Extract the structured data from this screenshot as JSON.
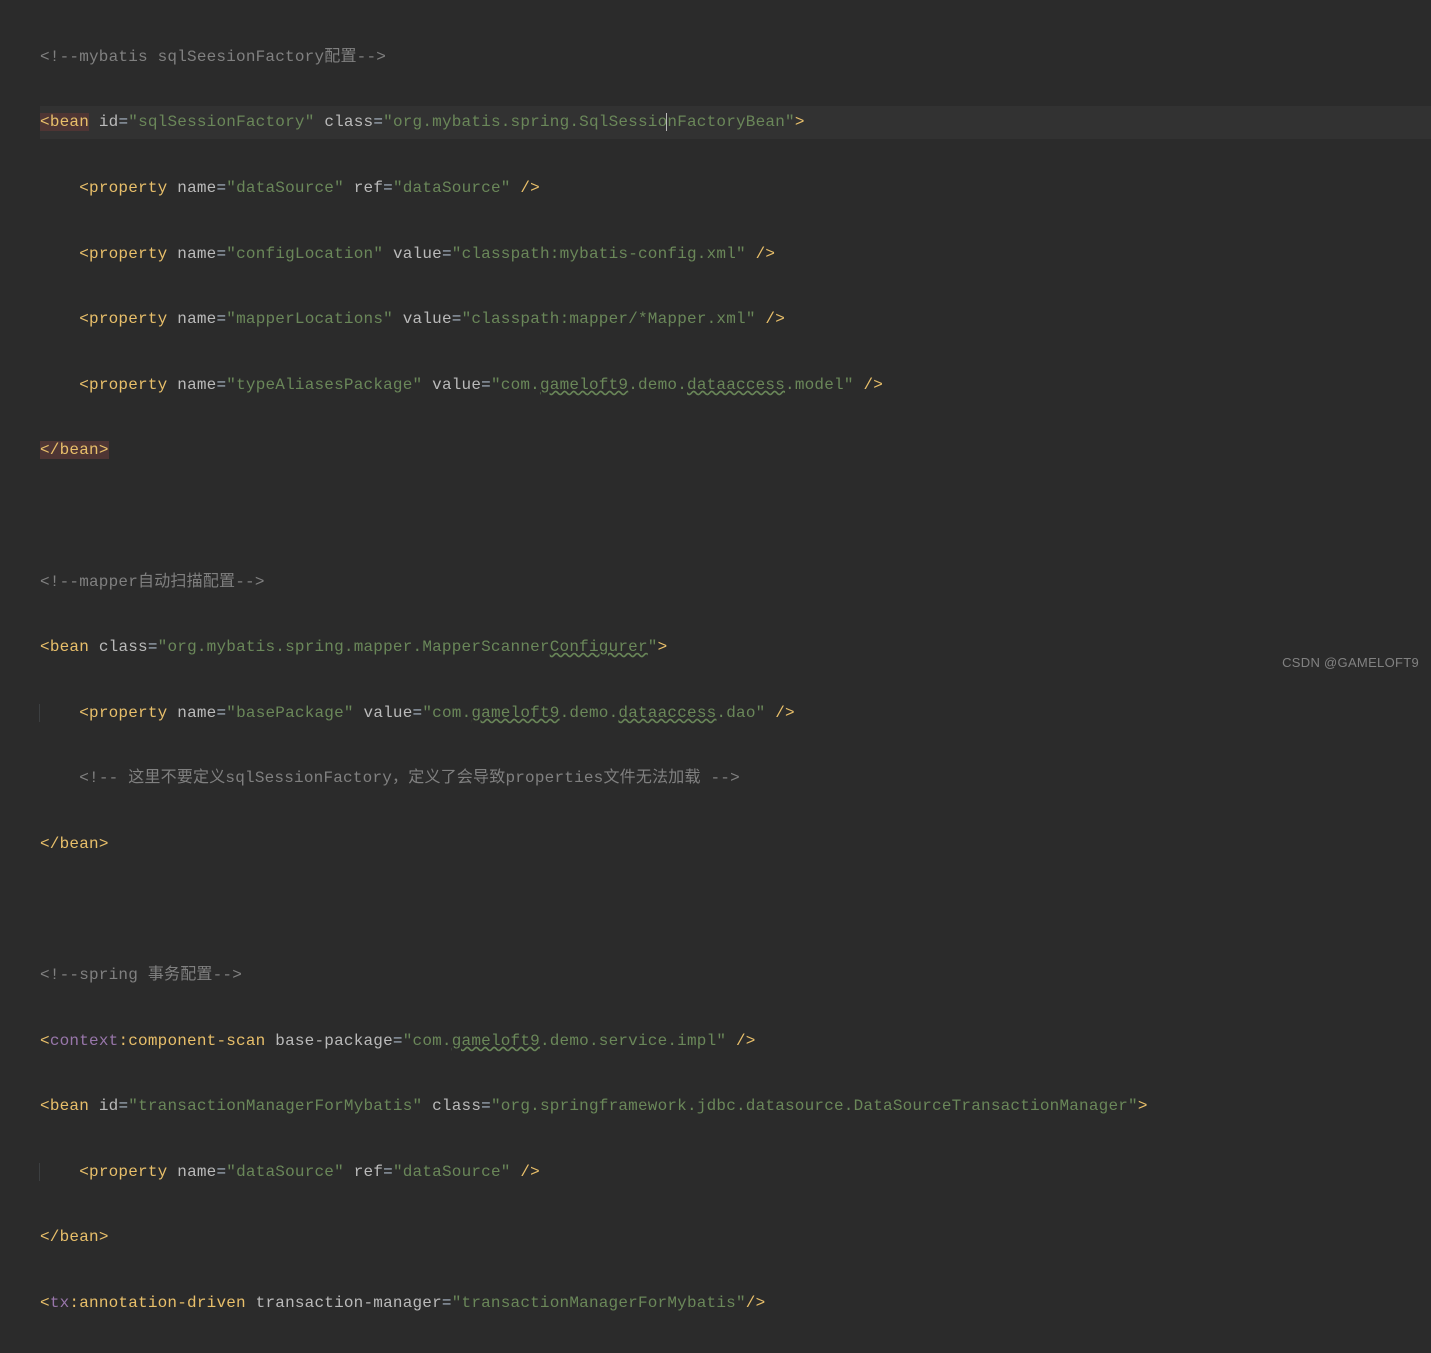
{
  "watermark": "CSDN @GAMELOFT9",
  "c1": "<!--mybatis sqlSeesionFactory配置-->",
  "bean1": {
    "tag": "bean",
    "idAttr": "id",
    "idVal": "\"sqlSessionFactory\"",
    "classAttr": "class",
    "classVal": "\"org.mybatis.spring.SqlSessionFactoryBean\"",
    "p1_name": "\"dataSource\"",
    "p1_refAttr": "ref",
    "p1_refVal": "\"dataSource\"",
    "p2_name": "\"configLocation\"",
    "p2_valAttr": "value",
    "p2_val": "\"classpath:mybatis-config.xml\"",
    "p3_name": "\"mapperLocations\"",
    "p3_val": "\"classpath:mapper/*Mapper.xml\"",
    "p4_name": "\"typeAliasesPackage\"",
    "p4_val_a": "\"com.",
    "p4_val_b": "gameloft9",
    "p4_val_c": ".demo.",
    "p4_val_d": "dataaccess",
    "p4_val_e": ".model\""
  },
  "c2": "<!--mapper自动扫描配置-->",
  "bean2": {
    "classVal_a": "\"org.mybatis.spring.mapper.MapperScanner",
    "classVal_b": "Configurer",
    "classVal_c": "\"",
    "p1_name": "\"basePackage\"",
    "p1_val_a": "\"com.",
    "p1_val_b": "gameloft9",
    "p1_val_c": ".demo.",
    "p1_val_d": "dataaccess",
    "p1_val_e": ".dao\"",
    "inner_cmt": "<!-- 这里不要定义sqlSessionFactory，定义了会导致properties文件无法加载 -->"
  },
  "c3": "<!--spring 事务配置-->",
  "scan": {
    "ns": "context",
    "tag": ":component-scan",
    "attr": "base-package",
    "val_a": "\"com.",
    "val_b": "gameloft9",
    "val_c": ".demo.service.impl\""
  },
  "bean3": {
    "idVal": "\"transactionManagerForMybatis\"",
    "classVal": "\"org.springframework.jdbc.datasource.DataSourceTransactionManager\"",
    "p1_name": "\"dataSource\"",
    "p1_refVal": "\"dataSource\""
  },
  "tx": {
    "ns": "tx",
    "tag": ":annotation-driven",
    "attr": "transaction-manager",
    "val": "\"transactionManagerForMybatis\""
  },
  "kw": {
    "property": "property",
    "name": "name",
    "value": "value",
    "bean": "bean",
    "class": "class",
    "id": "id",
    "ref": "ref",
    "beanClose": "</",
    "beanCloseTag": "bean",
    "close": ">",
    "selfclose": " />",
    "open": "<",
    "eq": "="
  }
}
